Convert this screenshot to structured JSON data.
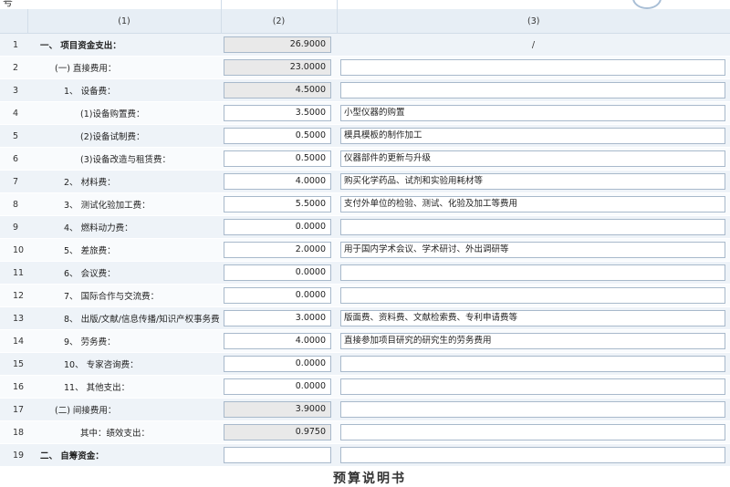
{
  "header": {
    "col1": "(1)",
    "col2": "(2)",
    "col3": "(3)"
  },
  "top_icon": "arc-icon",
  "top_glyph": "号",
  "rows": [
    {
      "num": "1",
      "label": "一、 项目资金支出：",
      "value": "26.9000",
      "desc": "/"
    },
    {
      "num": "2",
      "label": "(一) 直接费用：",
      "value": "23.0000",
      "desc": ""
    },
    {
      "num": "3",
      "label": "1、 设备费：",
      "value": "4.5000",
      "desc": ""
    },
    {
      "num": "4",
      "label": "(1)设备购置费：",
      "value": "3.5000",
      "desc": "小型仪器的购置"
    },
    {
      "num": "5",
      "label": "(2)设备试制费：",
      "value": "0.5000",
      "desc": "模具模板的制作加工"
    },
    {
      "num": "6",
      "label": "(3)设备改造与租赁费：",
      "value": "0.5000",
      "desc": "仪器部件的更新与升级"
    },
    {
      "num": "7",
      "label": "2、 材料费：",
      "value": "4.0000",
      "desc": "购买化学药品、试剂和实验用耗材等"
    },
    {
      "num": "8",
      "label": "3、 测试化验加工费：",
      "value": "5.5000",
      "desc": "支付外单位的检验、测试、化验及加工等费用"
    },
    {
      "num": "9",
      "label": "4、 燃料动力费：",
      "value": "0.0000",
      "desc": ""
    },
    {
      "num": "10",
      "label": "5、 差旅费：",
      "value": "2.0000",
      "desc": "用于国内学术会议、学术研讨、外出调研等"
    },
    {
      "num": "11",
      "label": "6、 会议费：",
      "value": "0.0000",
      "desc": ""
    },
    {
      "num": "12",
      "label": "7、 国际合作与交流费：",
      "value": "0.0000",
      "desc": ""
    },
    {
      "num": "13",
      "label": "8、 出版/文献/信息传播/知识产权事务费：",
      "value": "3.0000",
      "desc": "版面费、资料费、文献检索费、专利申请费等"
    },
    {
      "num": "14",
      "label": "9、 劳务费：",
      "value": "4.0000",
      "desc": "直接参加项目研究的研究生的劳务费用"
    },
    {
      "num": "15",
      "label": "10、 专家咨询费：",
      "value": "0.0000",
      "desc": ""
    },
    {
      "num": "16",
      "label": "11、 其他支出：",
      "value": "0.0000",
      "desc": ""
    },
    {
      "num": "17",
      "label": "(二) 间接费用：",
      "value": "3.9000",
      "desc": ""
    },
    {
      "num": "18",
      "label": "其中：绩效支出：",
      "value": "0.9750",
      "desc": ""
    },
    {
      "num": "19",
      "label": "二、 自筹资金：",
      "value": "",
      "desc": ""
    }
  ],
  "footer_title": "预算说明书"
}
